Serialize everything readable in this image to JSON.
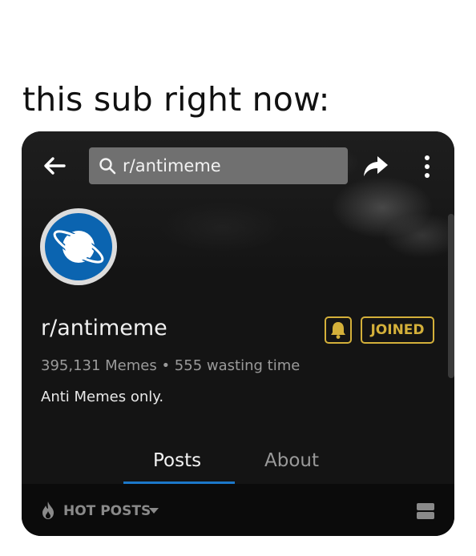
{
  "caption": "this sub right now:",
  "header": {
    "search_text": "r/antimeme",
    "back_icon": "back-arrow-icon",
    "share_icon": "share-icon",
    "more_icon": "more-vertical-icon"
  },
  "subreddit": {
    "name": "r/antimeme",
    "stats": "395,131 Memes • 555 wasting time",
    "description": "Anti Memes only.",
    "joined_label": "JOINED",
    "notification_icon": "bell-icon",
    "avatar_icon": "planet-icon"
  },
  "tabs": [
    {
      "label": "Posts",
      "active": true
    },
    {
      "label": "About",
      "active": false
    }
  ],
  "sort": {
    "label": "HOT POSTS",
    "icon": "flame-icon"
  },
  "colors": {
    "card_bg": "#141414",
    "accent_gold": "#d4b03a",
    "accent_blue": "#1c78c9",
    "avatar_blue": "#0b64b0"
  }
}
